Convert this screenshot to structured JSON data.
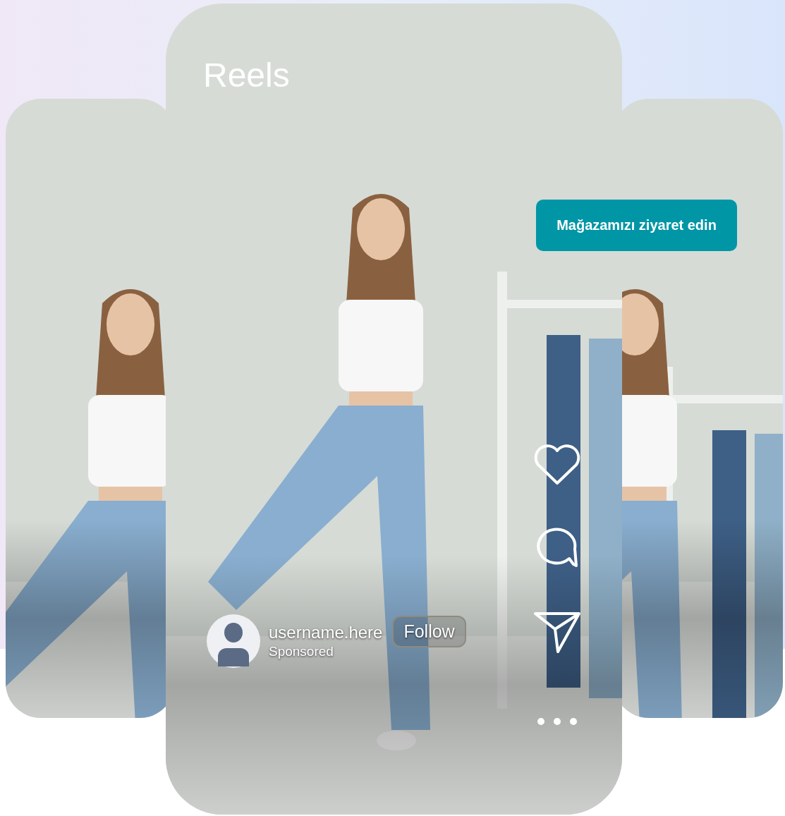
{
  "screen": {
    "title": "Reels"
  },
  "cta_button": {
    "label": "Mağazamızı ziyaret edin"
  },
  "post": {
    "username": "username.here",
    "subtitle": "Sponsored",
    "follow_label": "Follow"
  },
  "actions": [
    {
      "kind": "like"
    },
    {
      "kind": "comment"
    },
    {
      "kind": "share"
    }
  ]
}
